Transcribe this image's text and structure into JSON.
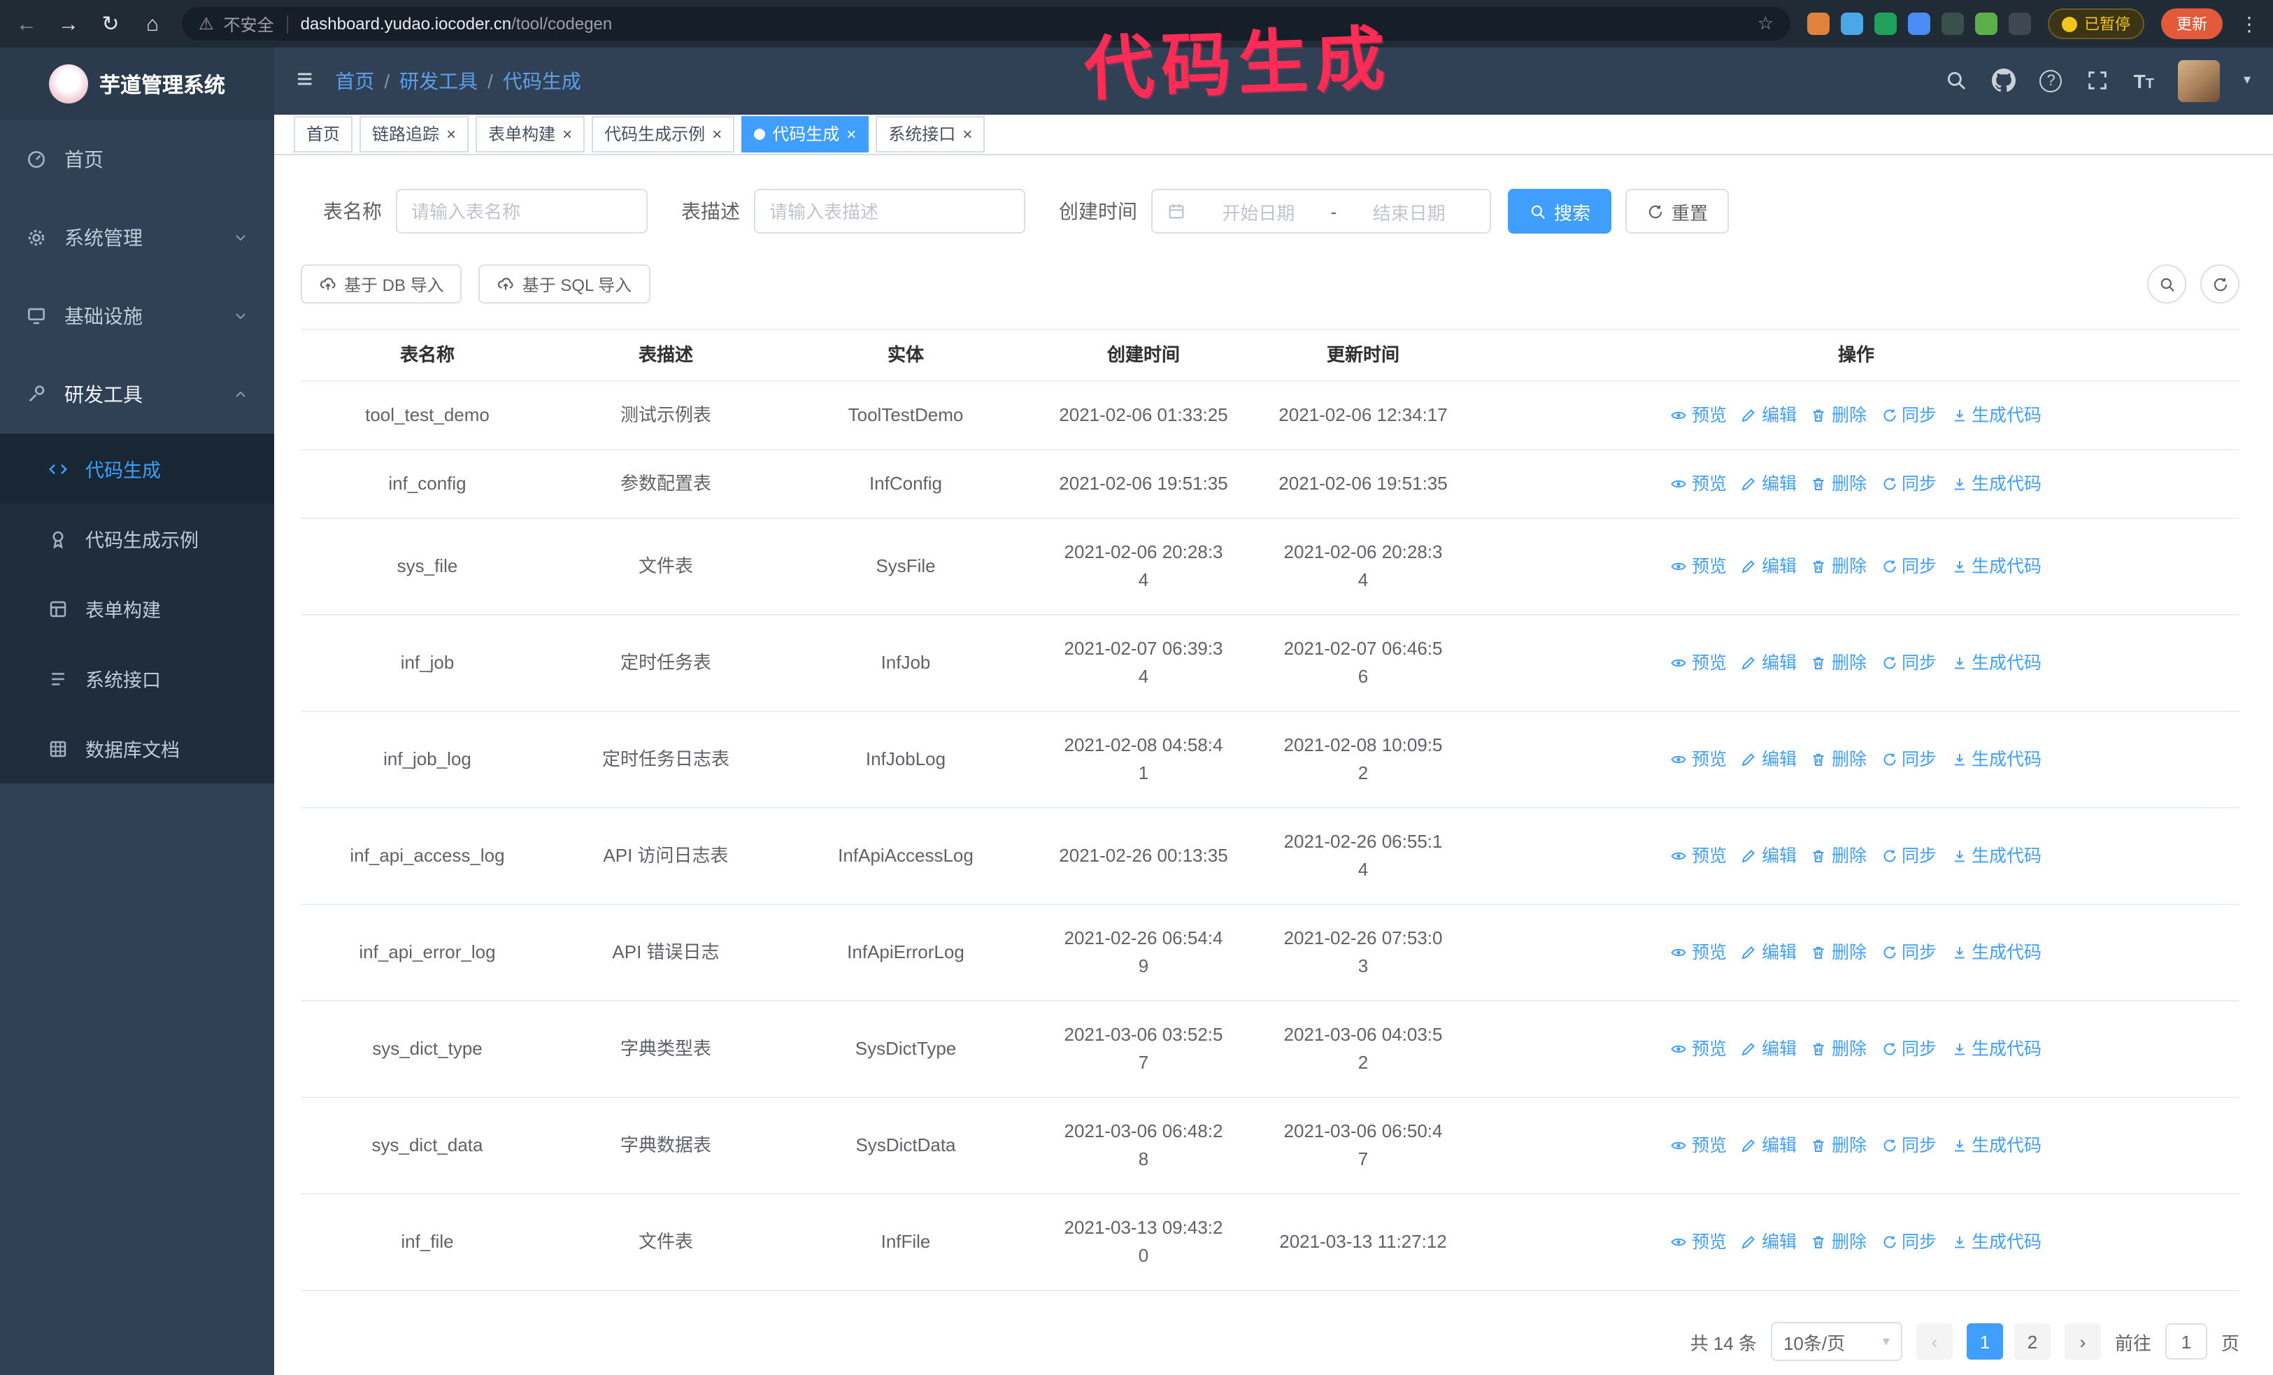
{
  "annotation": {
    "text": "代码生成",
    "color": "#ff2d55"
  },
  "browser": {
    "security_label": "不安全",
    "url_domain": "dashboard.yudao.iocoder.cn",
    "url_path": "/tool/codegen",
    "paused_badge": "已暂停",
    "update_button": "更新",
    "extensions": [
      {
        "name": "paw-extension",
        "color": "#e0813c"
      },
      {
        "name": "drop-extension",
        "color": "#4aa8e8"
      },
      {
        "name": "v-extension",
        "color": "#1fa15d"
      },
      {
        "name": "grid-extension",
        "color": "#4b8bf5"
      },
      {
        "name": "tile-extension",
        "color": "#39514a"
      },
      {
        "name": "leaf-extension",
        "color": "#5cae4a"
      },
      {
        "name": "flask-extension",
        "color": "#3f4750"
      }
    ]
  },
  "sidebar": {
    "logo_title": "芋道管理系统",
    "menu": [
      {
        "label": "首页",
        "icon": "dashboard",
        "arrow": null,
        "open": false
      },
      {
        "label": "系统管理",
        "icon": "gear",
        "arrow": "down",
        "open": false
      },
      {
        "label": "基础设施",
        "icon": "server",
        "arrow": "down",
        "open": false
      },
      {
        "label": "研发工具",
        "icon": "tool",
        "arrow": "up",
        "open": true
      }
    ],
    "submenu": [
      {
        "label": "代码生成",
        "icon": "code",
        "active": true
      },
      {
        "label": "代码生成示例",
        "icon": "medal",
        "active": false
      },
      {
        "label": "表单构建",
        "icon": "form",
        "active": false
      },
      {
        "label": "系统接口",
        "icon": "api",
        "active": false
      },
      {
        "label": "数据库文档",
        "icon": "db",
        "active": false
      }
    ]
  },
  "navbar": {
    "breadcrumb": [
      "首页",
      "研发工具",
      "代码生成"
    ]
  },
  "tabs": [
    {
      "label": "首页",
      "closable": false,
      "active": false
    },
    {
      "label": "链路追踪",
      "closable": true,
      "active": false
    },
    {
      "label": "表单构建",
      "closable": true,
      "active": false
    },
    {
      "label": "代码生成示例",
      "closable": true,
      "active": false
    },
    {
      "label": "代码生成",
      "closable": true,
      "active": true
    },
    {
      "label": "系统接口",
      "closable": true,
      "active": false
    }
  ],
  "filters": {
    "table_name_label": "表名称",
    "table_name_placeholder": "请输入表名称",
    "table_desc_label": "表描述",
    "table_desc_placeholder": "请输入表描述",
    "create_time_label": "创建时间",
    "date_start_placeholder": "开始日期",
    "date_separator": "-",
    "date_end_placeholder": "结束日期",
    "search_button": "搜索",
    "reset_button": "重置"
  },
  "toolbar": {
    "import_db_label": "基于 DB 导入",
    "import_sql_label": "基于 SQL 导入"
  },
  "table": {
    "columns": [
      "表名称",
      "表描述",
      "实体",
      "创建时间",
      "更新时间",
      "操作"
    ],
    "actions": [
      {
        "label": "预览",
        "icon": "eye"
      },
      {
        "label": "编辑",
        "icon": "edit"
      },
      {
        "label": "删除",
        "icon": "trash"
      },
      {
        "label": "同步",
        "icon": "sync"
      },
      {
        "label": "生成代码",
        "icon": "download"
      }
    ],
    "rows": [
      {
        "name": "tool_test_demo",
        "desc": "测试示例表",
        "entity": "ToolTestDemo",
        "created": "2021-02-06 01:33:25",
        "updated": "2021-02-06 12:34:17"
      },
      {
        "name": "inf_config",
        "desc": "参数配置表",
        "entity": "InfConfig",
        "created": "2021-02-06 19:51:35",
        "updated": "2021-02-06 19:51:35"
      },
      {
        "name": "sys_file",
        "desc": "文件表",
        "entity": "SysFile",
        "created": "2021-02-06 20:28:3\n4",
        "updated": "2021-02-06 20:28:3\n4"
      },
      {
        "name": "inf_job",
        "desc": "定时任务表",
        "entity": "InfJob",
        "created": "2021-02-07 06:39:3\n4",
        "updated": "2021-02-07 06:46:5\n6"
      },
      {
        "name": "inf_job_log",
        "desc": "定时任务日志表",
        "entity": "InfJobLog",
        "created": "2021-02-08 04:58:4\n1",
        "updated": "2021-02-08 10:09:5\n2"
      },
      {
        "name": "inf_api_access_log",
        "desc": "API 访问日志表",
        "entity": "InfApiAccessLog",
        "created": "2021-02-26 00:13:35",
        "updated": "2021-02-26 06:55:1\n4"
      },
      {
        "name": "inf_api_error_log",
        "desc": "API 错误日志",
        "entity": "InfApiErrorLog",
        "created": "2021-02-26 06:54:4\n9",
        "updated": "2021-02-26 07:53:0\n3"
      },
      {
        "name": "sys_dict_type",
        "desc": "字典类型表",
        "entity": "SysDictType",
        "created": "2021-03-06 03:52:5\n7",
        "updated": "2021-03-06 04:03:5\n2"
      },
      {
        "name": "sys_dict_data",
        "desc": "字典数据表",
        "entity": "SysDictData",
        "created": "2021-03-06 06:48:2\n8",
        "updated": "2021-03-06 06:50:4\n7"
      },
      {
        "name": "inf_file",
        "desc": "文件表",
        "entity": "InfFile",
        "created": "2021-03-13 09:43:2\n0",
        "updated": "2021-03-13 11:27:12"
      }
    ]
  },
  "pagination": {
    "total_text": "共 14 条",
    "page_size_value": "10条/页",
    "pages": [
      "1",
      "2"
    ],
    "active_page": "1",
    "prev_symbol": "‹",
    "next_symbol": "›",
    "goto_label": "前往",
    "goto_value": "1",
    "goto_unit": "页"
  },
  "colors": {
    "accent": "#409EFF",
    "sidebar_bg": "#304156",
    "submenu_bg": "#1f2d3d"
  },
  "icons": [
    "back-icon",
    "forward-icon",
    "reload-icon",
    "home-icon",
    "warning-icon",
    "star-icon",
    "menu-dots-icon",
    "hamburger-icon",
    "search-icon",
    "github-icon",
    "question-icon",
    "fullscreen-icon",
    "font-size-icon",
    "calendar-icon",
    "cloud-upload-icon",
    "refresh-icon",
    "eye-icon",
    "edit-icon",
    "delete-icon",
    "sync-icon",
    "download-icon"
  ]
}
